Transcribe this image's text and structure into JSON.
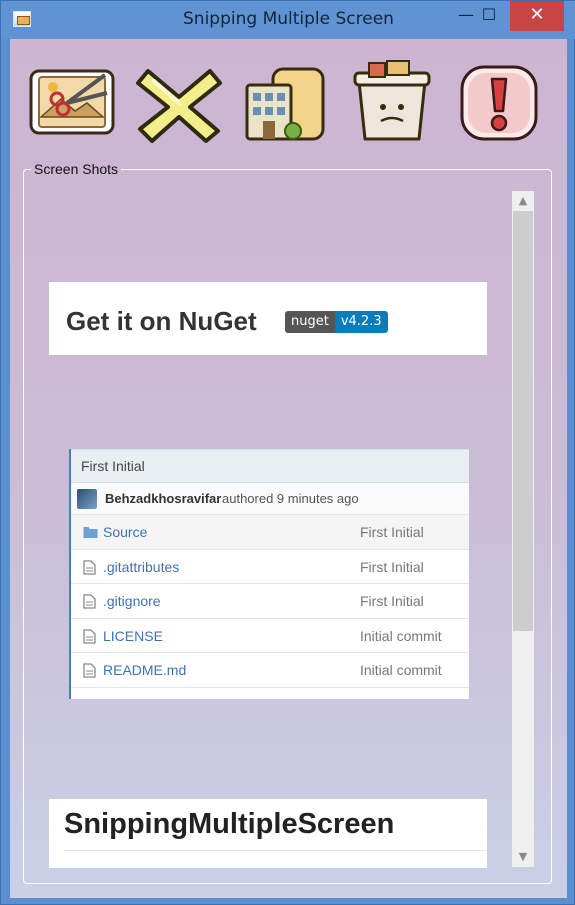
{
  "window": {
    "title": "Snipping Multiple Screen",
    "minimize": "—",
    "maximize": "☐",
    "close": "✕"
  },
  "toolbar": {
    "items": [
      "new-snip",
      "delete",
      "save",
      "clear",
      "about"
    ]
  },
  "group": {
    "label": "Screen Shots"
  },
  "scrollbar": {
    "up": "▲",
    "down": "▼"
  },
  "screenshots": {
    "nuget": {
      "title": "Get it on NuGet",
      "badge_label": "nuget",
      "badge_version": "v4.2.3"
    },
    "repo": {
      "header": "First Initial",
      "author": "Behzadkhosravifar",
      "authored": "authored 9 minutes ago",
      "rows": [
        {
          "name": "Source",
          "message": "First Initial",
          "type": "folder"
        },
        {
          "name": ".gitattributes",
          "message": "First Initial",
          "type": "file"
        },
        {
          "name": ".gitignore",
          "message": "First Initial",
          "type": "file"
        },
        {
          "name": "LICENSE",
          "message": "Initial commit",
          "type": "file"
        },
        {
          "name": "README.md",
          "message": "Initial commit",
          "type": "file"
        }
      ]
    },
    "heading": {
      "title": "SnippingMultipleScreen"
    }
  },
  "colors": {
    "accent": "#5b8fcf",
    "close": "#c94545",
    "link": "#3f72b0",
    "badge_version": "#0a7bbb"
  }
}
